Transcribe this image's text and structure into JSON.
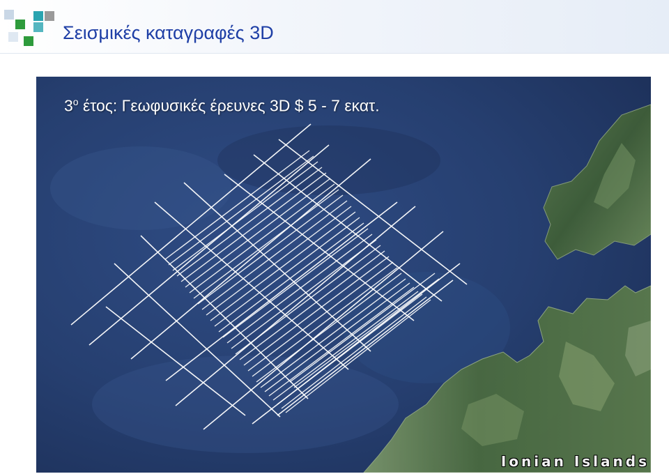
{
  "slide": {
    "title": "Σεισμικές καταγραφές 3D"
  },
  "map": {
    "caption_prefix": "3",
    "caption_superscript": "ο",
    "caption_rest": " έτος: Γεωφυσικές έρευνες 3D  $ 5 - 7 εκατ.",
    "label": "Ionian Islands"
  },
  "colors": {
    "title": "#1f3fa6",
    "sea": "#2a4478",
    "land": "#4d6e42",
    "survey_lines": "#ffffff",
    "logo_green": "#2e9b3c",
    "logo_teal": "#2aa4b0",
    "logo_gray": "#8a8a8a"
  },
  "icons": [
    "logo-squares-icon"
  ]
}
